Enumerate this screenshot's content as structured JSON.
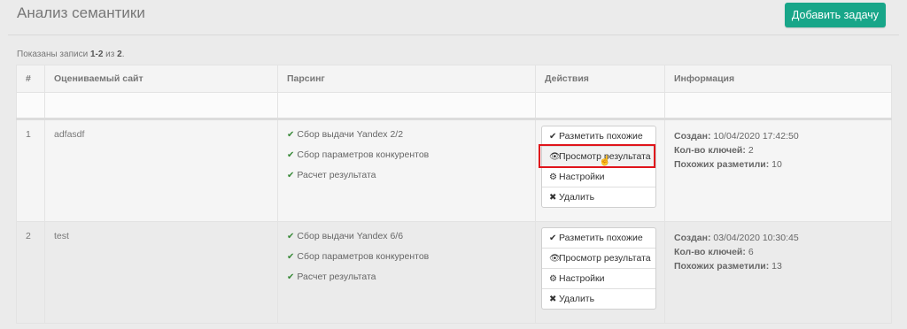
{
  "header": {
    "title": "Анализ семантики",
    "add_button": "Добавить задачу"
  },
  "summary": {
    "prefix": "Показаны записи ",
    "range": "1-2",
    "middle": " из ",
    "total": "2",
    "suffix": "."
  },
  "table": {
    "columns": [
      "#",
      "Оцениваемый сайт",
      "Парсинг",
      "Действия",
      "Информация"
    ],
    "rows": [
      {
        "num": "1",
        "site": "adfasdf",
        "parsing": [
          "Сбор выдачи Yandex 2/2",
          "Сбор параметров конкурентов",
          "Расчет результата"
        ],
        "actions": [
          "Разметить похожие",
          "Просмотр результата",
          "Настройки",
          "Удалить"
        ],
        "info": {
          "created_label": "Создан",
          "created_value": "10/04/2020 17:42:50",
          "keys_label": "Кол-во ключей",
          "keys_value": "2",
          "similar_label": "Похожих разметили",
          "similar_value": "10"
        }
      },
      {
        "num": "2",
        "site": "test",
        "parsing": [
          "Сбор выдачи Yandex 6/6",
          "Сбор параметров конкурентов",
          "Расчет результата"
        ],
        "actions": [
          "Разметить похожие",
          "Просмотр результата",
          "Настройки",
          "Удалить"
        ],
        "info": {
          "created_label": "Создан",
          "created_value": "03/04/2020 10:30:45",
          "keys_label": "Кол-во ключей",
          "keys_value": "6",
          "similar_label": "Похожих разметили",
          "similar_value": "13"
        }
      }
    ]
  },
  "icons": {
    "check": "check-icon",
    "mark_similar": "check-icon",
    "view_result": "eye-icon",
    "settings": "gear-icon",
    "delete": "close-icon"
  },
  "colors": {
    "accent": "#18a689",
    "highlight": "#e0141b",
    "check": "#3a8a3a"
  }
}
